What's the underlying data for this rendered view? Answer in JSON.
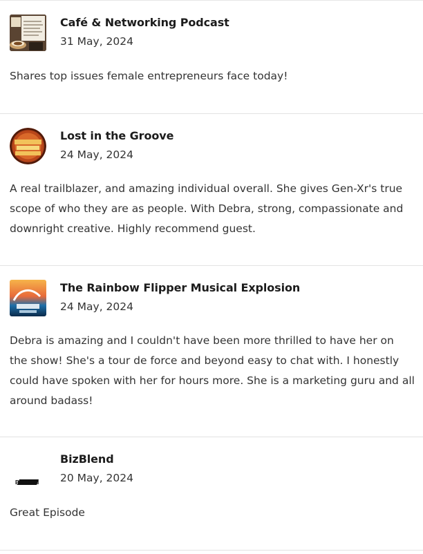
{
  "reviews": [
    {
      "podcast": "Café & Networking Podcast",
      "date": "31 May, 2024",
      "text": "Shares top issues female entrepreneurs face today!",
      "avatar_icon": "cafe-networking-podcast-logo"
    },
    {
      "podcast": "Lost in the Groove",
      "date": "24 May, 2024",
      "text": "A real trailblazer, and amazing individual overall. She gives Gen-Xr's true scope of who they are as people. With Debra, strong, compassionate and downright creative. Highly recommend guest.",
      "avatar_icon": "lost-in-the-groove-logo"
    },
    {
      "podcast": "The Rainbow Flipper Musical Explosion",
      "date": "24 May, 2024",
      "text": "Debra is amazing and I couldn't have been more thrilled to have her on the show! She's a tour de force and beyond easy to chat with. I honestly could have spoken with her for hours more. She is a marketing guru and all around badass!",
      "avatar_icon": "rainbow-flipper-logo"
    },
    {
      "podcast": "BizBlend",
      "date": "20 May, 2024",
      "text": "Great Episode",
      "avatar_icon": "bizblend-logo",
      "avatar_text": "BizBlend"
    }
  ]
}
